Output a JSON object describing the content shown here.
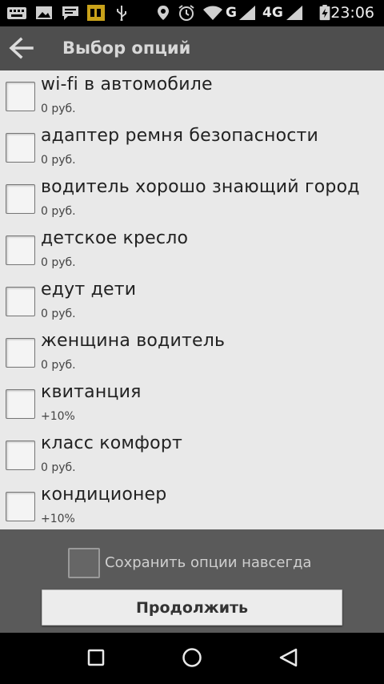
{
  "status_bar": {
    "time": "23:06",
    "network_g": "G",
    "network_4g": "4G",
    "icons": [
      "notification-icon",
      "image-icon",
      "chat-icon",
      "sim-icon",
      "usb-icon",
      "location-icon",
      "alarm-icon",
      "wifi-icon",
      "signal-icon",
      "signal-icon",
      "battery-icon"
    ]
  },
  "header": {
    "title": "Выбор опций",
    "back_icon": "arrow-left-icon"
  },
  "options": [
    {
      "label": "wi-fi в автомобиле",
      "price": "0 руб.",
      "checked": false
    },
    {
      "label": "адаптер ремня безопасности",
      "price": "0 руб.",
      "checked": false
    },
    {
      "label": "водитель хорошо знающий город",
      "price": "0 руб.",
      "checked": false
    },
    {
      "label": "детское кресло",
      "price": "0 руб.",
      "checked": false
    },
    {
      "label": "едут дети",
      "price": "0 руб.",
      "checked": false
    },
    {
      "label": "женщина водитель",
      "price": "0 руб.",
      "checked": false
    },
    {
      "label": "квитанция",
      "price": "+10%",
      "checked": false
    },
    {
      "label": "класс комфорт",
      "price": "0 руб.",
      "checked": false
    },
    {
      "label": "кондиционер",
      "price": "+10%",
      "checked": false
    }
  ],
  "footer": {
    "save_label": "Сохранить опции навсегда",
    "save_checked": false,
    "continue_label": "Продолжить"
  },
  "nav_bar": {
    "icons": [
      "recent-apps-icon",
      "home-icon",
      "back-icon"
    ]
  },
  "colors": {
    "action_bar": "#4e4e4e",
    "list_background": "#e9e9e9",
    "bottom_panel": "#5a5a5a"
  }
}
